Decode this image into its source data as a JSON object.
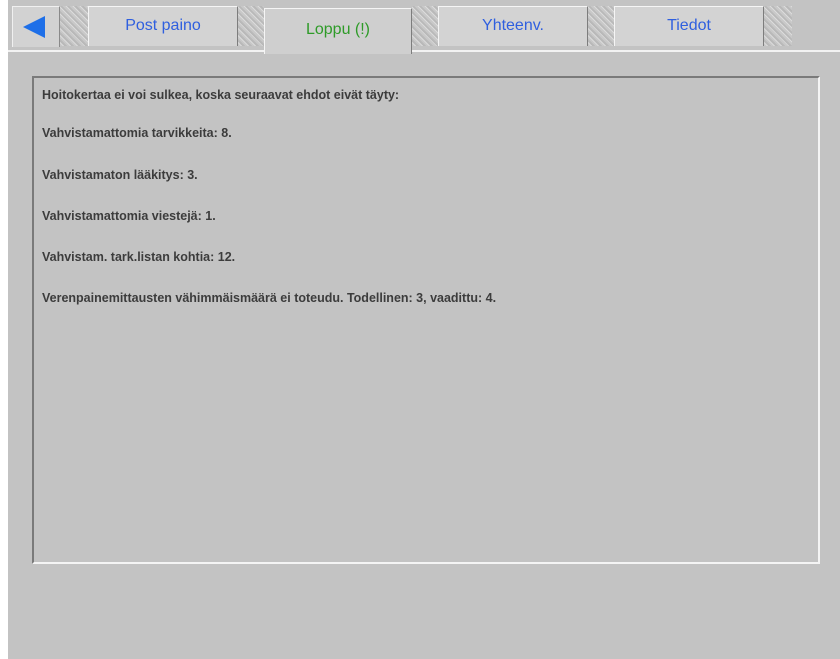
{
  "tabs": [
    {
      "label": "Post paino",
      "active": false
    },
    {
      "label": "Loppu (!)",
      "active": true
    },
    {
      "label": "Yhteenv.",
      "active": false
    },
    {
      "label": "Tiedot",
      "active": false
    }
  ],
  "icons": {
    "back": "left-arrow-icon"
  },
  "colors": {
    "tab_text": "#2f5fdf",
    "active_tab_text": "#2e9b28",
    "back_arrow": "#1e6fe8",
    "background": "#c3c3c3"
  },
  "messages": {
    "heading": "Hoitokertaa ei voi sulkea, koska seuraavat ehdot eivät täyty:",
    "items": [
      "Vahvistamattomia tarvikkeita: 8.",
      "Vahvistamaton lääkitys: 3.",
      "Vahvistamattomia viestejä: 1.",
      "Vahvistam. tark.listan kohtia: 12.",
      "Verenpainemittausten vähimmäismäärä ei toteudu. Todellinen: 3, vaadittu: 4."
    ]
  }
}
